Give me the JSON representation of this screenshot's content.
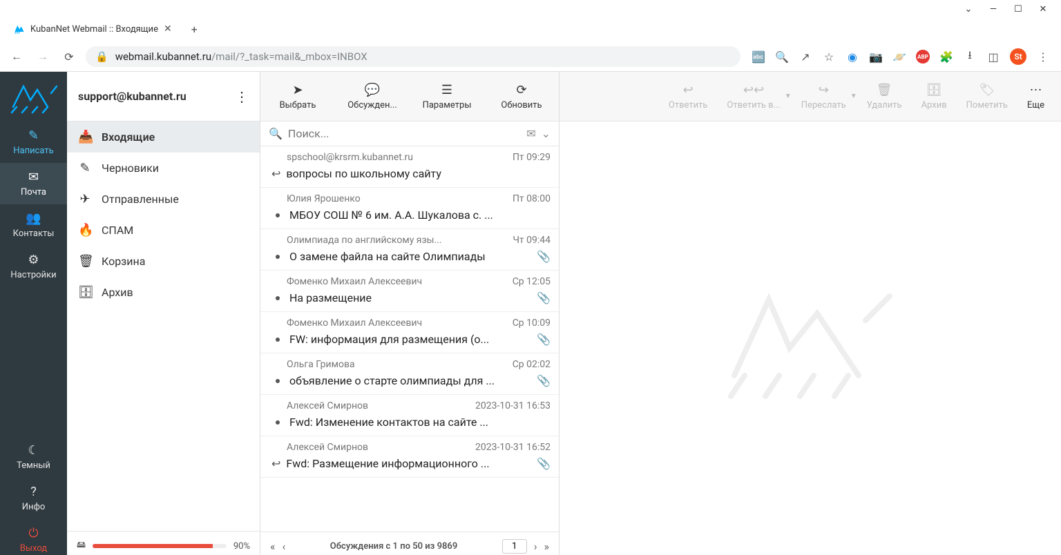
{
  "window": {
    "tab_title": "KubanNet Webmail :: Входящие",
    "url_host": "webmail.kubannet.ru",
    "url_path": "/mail/?_task=mail&_mbox=INBOX",
    "avatar": "St"
  },
  "leftnav": {
    "compose": "Написать",
    "mail": "Почта",
    "contacts": "Контакты",
    "settings": "Настройки",
    "dark": "Темный",
    "info": "Инфо",
    "exit": "Выход"
  },
  "account_email": "support@kubannet.ru",
  "folders": [
    {
      "label": "Входящие",
      "icon": "inbox",
      "active": true
    },
    {
      "label": "Черновики",
      "icon": "pencil",
      "active": false
    },
    {
      "label": "Отправленные",
      "icon": "paper-plane",
      "active": false
    },
    {
      "label": "СПАМ",
      "icon": "fire",
      "active": false
    },
    {
      "label": "Корзина",
      "icon": "trash",
      "active": false
    },
    {
      "label": "Архив",
      "icon": "archive",
      "active": false
    }
  ],
  "quota_percent": "90%",
  "msg_toolbar": {
    "select": "Выбрать",
    "threads": "Обсужден...",
    "options": "Параметры",
    "refresh": "Обновить"
  },
  "search_placeholder": "Поиск...",
  "messages": [
    {
      "from": "spschool@krsrm.kubannet.ru",
      "date": "Пт 09:29",
      "subject": "вопросы по школьному сайту",
      "reply": true,
      "attach": false
    },
    {
      "from": "Юлия Ярошенко",
      "date": "Пт 08:00",
      "subject": "МБОУ СОШ № 6 им. А.А. Шукалова с. ...",
      "reply": false,
      "attach": false
    },
    {
      "from": "Олимпиада по английскому язы...",
      "date": "Чт 09:44",
      "subject": "О замене файла на сайте Олимпиады",
      "reply": false,
      "attach": true
    },
    {
      "from": "Фоменко Михаил Алексеевич",
      "date": "Ср 12:05",
      "subject": "На размещение",
      "reply": false,
      "attach": true
    },
    {
      "from": "Фоменко Михаил Алексеевич",
      "date": "Ср 10:09",
      "subject": "FW: информация для размещения (о...",
      "reply": false,
      "attach": true
    },
    {
      "from": "Ольга Гримова",
      "date": "Ср 02:02",
      "subject": "объявление о старте олимпиады для ...",
      "reply": false,
      "attach": true
    },
    {
      "from": "Алексей Смирнов",
      "date": "2023-10-31 16:53",
      "subject": "Fwd: Изменение контактов на сайте ...",
      "reply": false,
      "attach": false
    },
    {
      "from": "Алексей Смирнов",
      "date": "2023-10-31 16:52",
      "subject": "Fwd: Размещение информационного ...",
      "reply": true,
      "attach": true
    }
  ],
  "pager": {
    "info": "Обсуждения с 1 по 50 из 9869",
    "page": "1"
  },
  "preview_toolbar": {
    "reply": "Ответить",
    "reply_all": "Ответить в...",
    "forward": "Переслать",
    "delete": "Удалить",
    "archive": "Архив",
    "mark": "Пометить",
    "more": "Еще"
  }
}
